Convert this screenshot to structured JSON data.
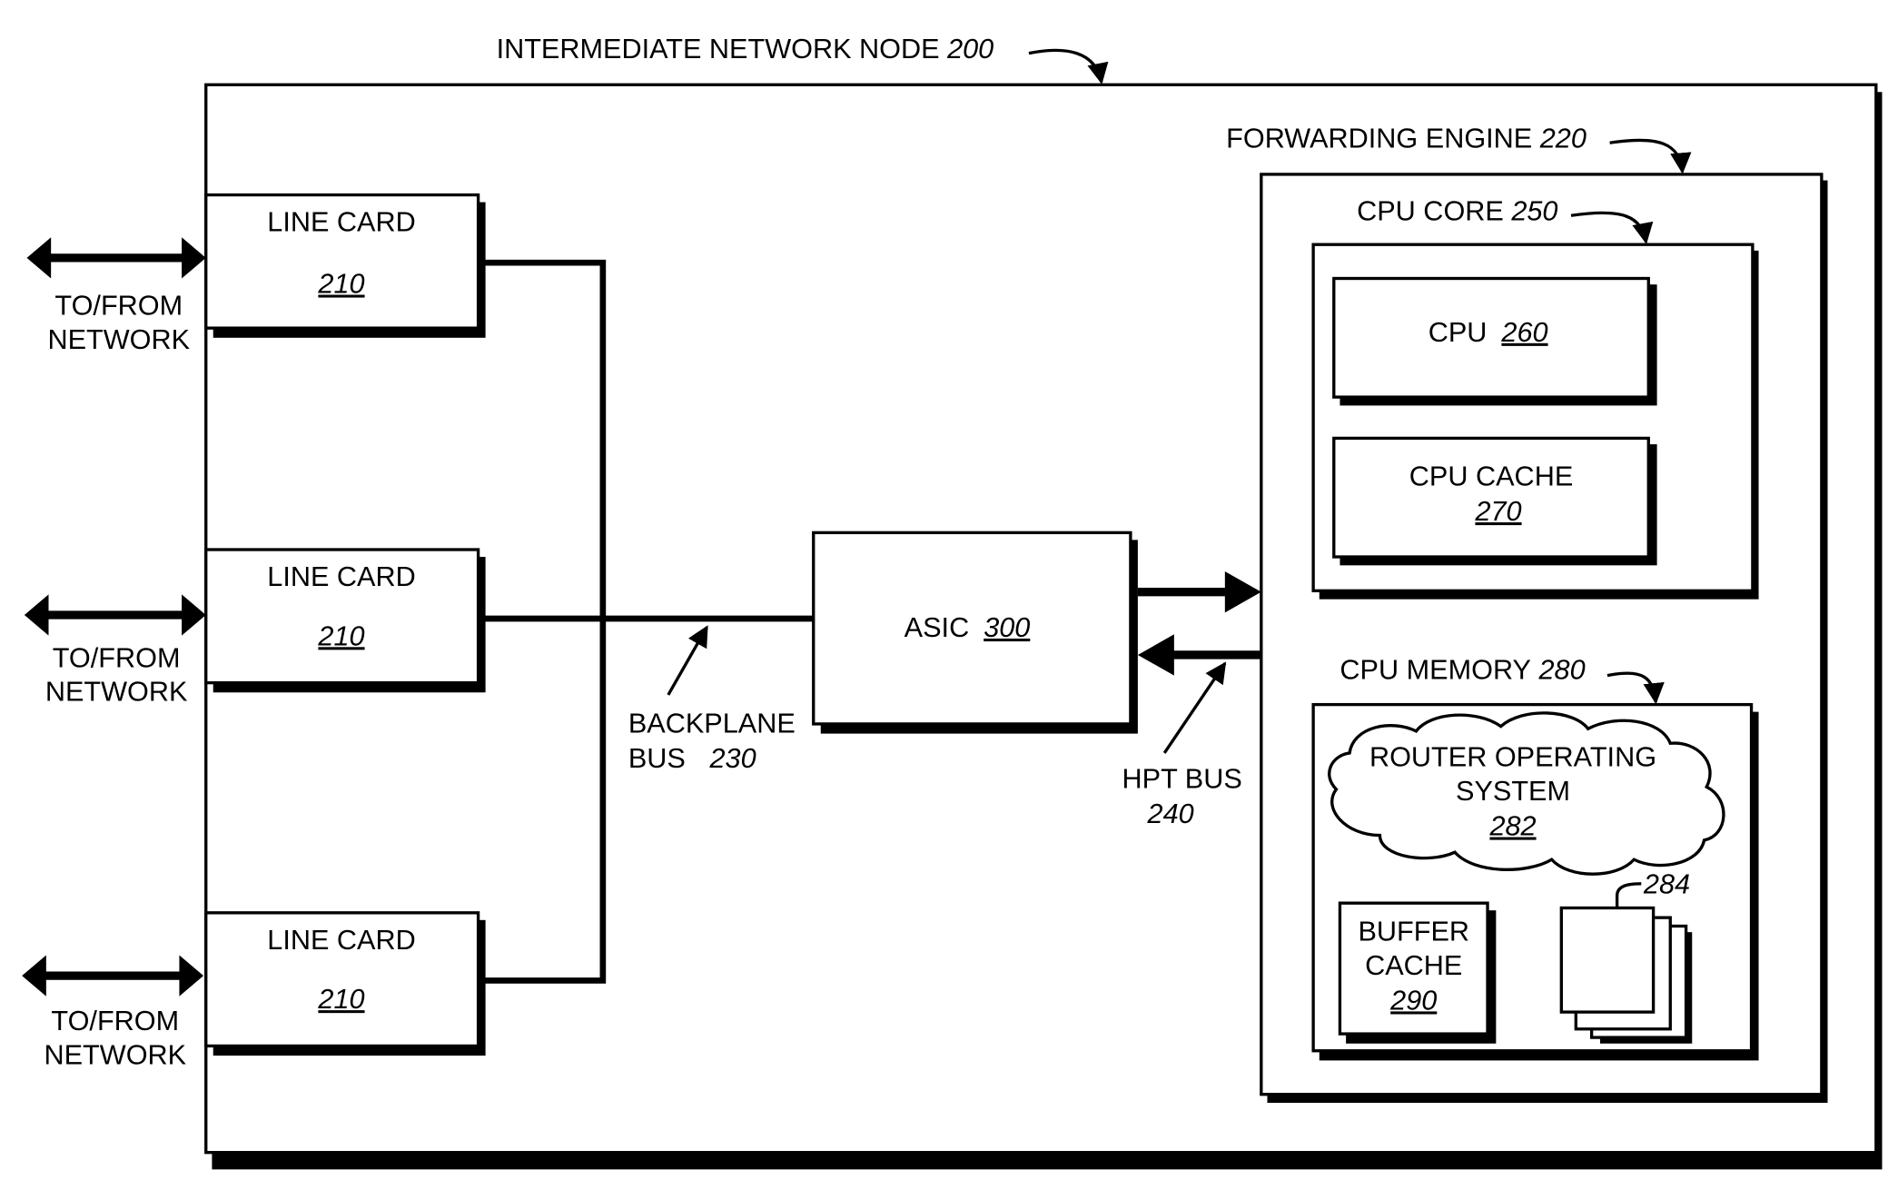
{
  "node": {
    "label": "INTERMEDIATE NETWORK NODE",
    "ref": "200"
  },
  "network_label_1": "TO/FROM",
  "network_label_2": "NETWORK",
  "line_cards": [
    {
      "label": "LINE CARD",
      "ref": "210"
    },
    {
      "label": "LINE CARD",
      "ref": "210"
    },
    {
      "label": "LINE CARD",
      "ref": "210"
    }
  ],
  "backplane_bus": {
    "label_1": "BACKPLANE",
    "label_2": "BUS",
    "ref": "230"
  },
  "asic": {
    "label": "ASIC",
    "ref": "300"
  },
  "hpt_bus": {
    "label": "HPT BUS",
    "ref": "240"
  },
  "forwarding_engine": {
    "label": "FORWARDING ENGINE",
    "ref": "220"
  },
  "cpu_core": {
    "label": "CPU CORE",
    "ref": "250"
  },
  "cpu": {
    "label": "CPU",
    "ref": "260"
  },
  "cpu_cache": {
    "label": "CPU CACHE",
    "ref": "270"
  },
  "cpu_memory": {
    "label": "CPU MEMORY",
    "ref": "280"
  },
  "router_os": {
    "label_1": "ROUTER OPERATING",
    "label_2": "SYSTEM",
    "ref": "282"
  },
  "buffer_cache": {
    "label_1": "BUFFER",
    "label_2": "CACHE",
    "ref": "290"
  },
  "pages": {
    "ref": "284"
  }
}
